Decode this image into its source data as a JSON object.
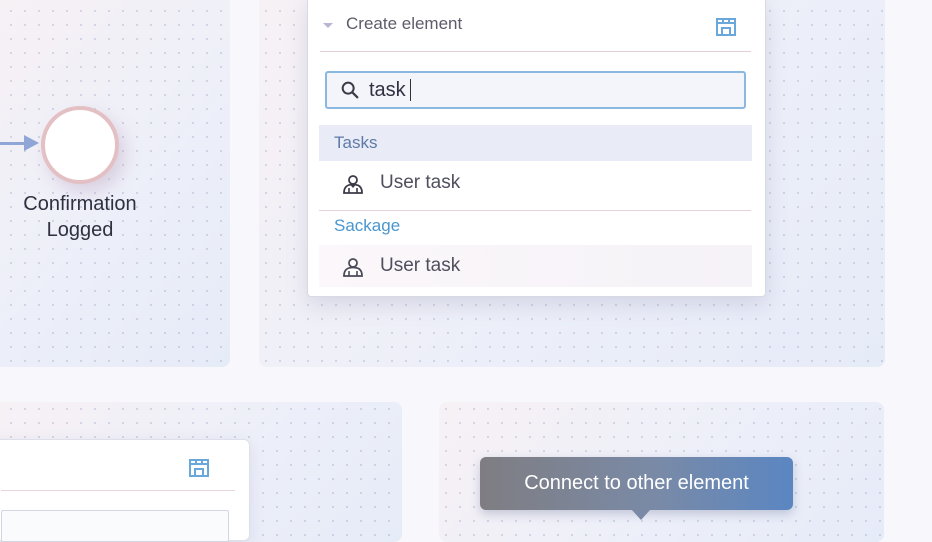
{
  "canvas": {
    "event": {
      "label": "Confirmation Logged"
    }
  },
  "create_popup": {
    "title": "Create element",
    "search": {
      "value": "task",
      "placeholder": ""
    },
    "groups": [
      {
        "name": "Tasks",
        "entries": [
          {
            "label": "User task",
            "icon": "user-task-icon"
          }
        ]
      },
      {
        "name": "Sackage",
        "entries": [
          {
            "label": "User task",
            "icon": "user-task-icon"
          }
        ]
      }
    ],
    "header_icon": "store-icon"
  },
  "tooltip": {
    "text": "Connect to other element"
  },
  "colors": {
    "accent": "#8bb8e0",
    "group_tasks": "#5f7aa8",
    "group_sackage": "#4a96d0",
    "tooltip_start": "#7f7d82",
    "tooltip_end": "#5b86c2"
  }
}
